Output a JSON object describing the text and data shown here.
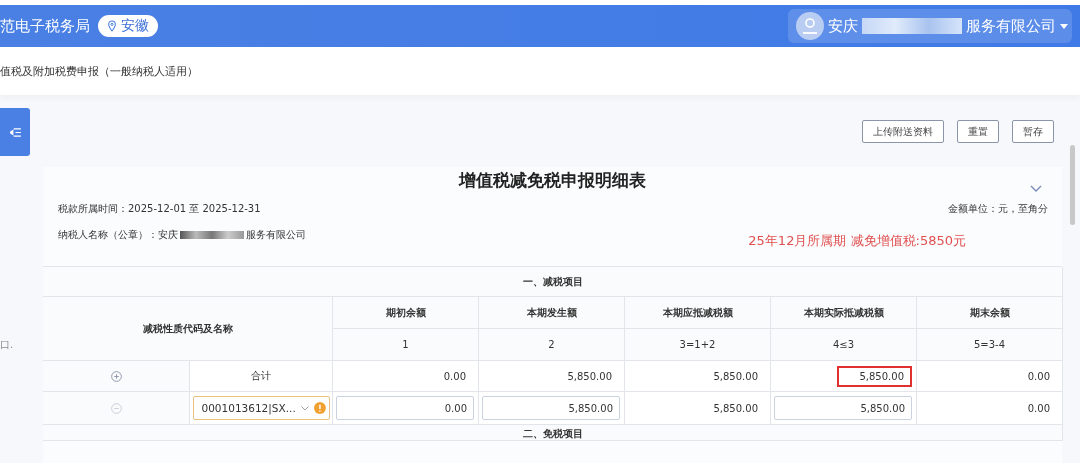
{
  "header": {
    "site_title": "范电子税务局",
    "region": "安徽",
    "user": {
      "name_start": "安庆",
      "name_end": "服务有限公司"
    }
  },
  "breadcrumb": "值税及附加税费申报（一般纳税人适用）",
  "side_note": "口.",
  "toolbar": {
    "buttons": [
      "上传附送资料",
      "重置",
      "暂存"
    ]
  },
  "form": {
    "title": "增值税减免税申报明细表",
    "period": "税款所属时间：2025-12-01 至 2025-12-31",
    "unit": "金额单位：元，至角分",
    "taxpayer_start": "纳税人名称（公章）：安庆",
    "taxpayer_end": "服务有限公司",
    "note": "25年12月所属期 减免增值税:5850元",
    "table": {
      "section": "一、减税项目",
      "name_header": "减税性质代码及名称",
      "columns": [
        {
          "title": "期初余额",
          "formula": "1"
        },
        {
          "title": "本期发生额",
          "formula": "2"
        },
        {
          "title": "本期应抵减税额",
          "formula": "3=1+2"
        },
        {
          "title": "本期实际抵减税额",
          "formula": "4≤3"
        },
        {
          "title": "期末余额",
          "formula": "5=3-4"
        }
      ],
      "rows": [
        {
          "kind": "total",
          "label": "合计",
          "cells": [
            {
              "value": "0.00",
              "editable": false,
              "highlighted": false
            },
            {
              "value": "5,850.00",
              "editable": false,
              "highlighted": false
            },
            {
              "value": "5,850.00",
              "editable": false,
              "highlighted": false
            },
            {
              "value": "5,850.00",
              "editable": false,
              "highlighted": true
            },
            {
              "value": "0.00",
              "editable": false,
              "highlighted": false
            }
          ]
        },
        {
          "kind": "item",
          "select_value": "0001013612|SX...",
          "warning": true,
          "cells": [
            {
              "value": "0.00",
              "editable": true,
              "highlighted": false
            },
            {
              "value": "5,850.00",
              "editable": true,
              "highlighted": false
            },
            {
              "value": "5,850.00",
              "editable": false,
              "highlighted": false
            },
            {
              "value": "5,850.00",
              "editable": true,
              "highlighted": false
            },
            {
              "value": "0.00",
              "editable": false,
              "highlighted": false
            }
          ]
        }
      ],
      "next_section": "二、免税项目"
    }
  }
}
